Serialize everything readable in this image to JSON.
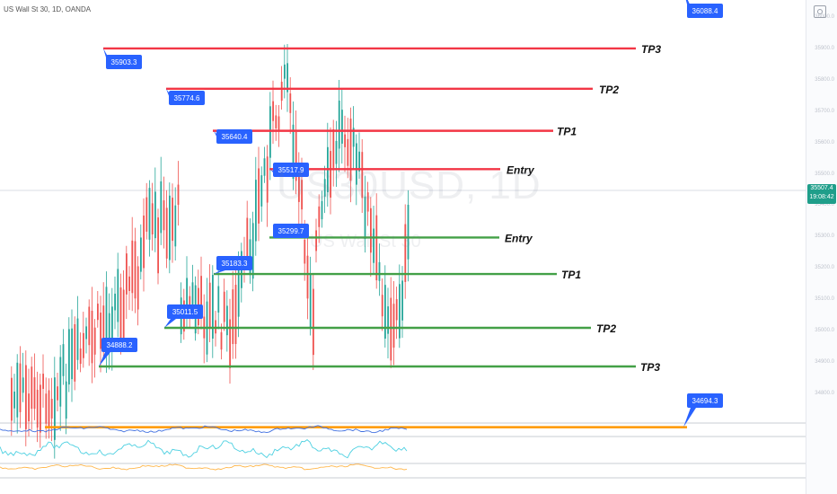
{
  "header": {
    "symbol_line": "US Wall St 30, 1D, OANDA"
  },
  "watermark": {
    "symbol": "US30USD, 1D",
    "name": "US Wall St 30"
  },
  "price_axis": {
    "current_price": "35507.4",
    "countdown": "19:08:42",
    "ticks": [
      "36100.0",
      "36000.0",
      "35900.0",
      "35800.0",
      "35700.0",
      "35600.0",
      "35500.0",
      "35400.0",
      "35300.0",
      "35200.0",
      "35100.0",
      "35000.0",
      "34900.0",
      "34800.0",
      "34700.0",
      "34600.0"
    ]
  },
  "colors": {
    "bull": "#26a69a",
    "bear": "#ef5350",
    "label_bg": "#2962ff",
    "range_line": "#ff9800",
    "short_line": "#f23645",
    "long_line": "#43a047",
    "osc1": "#3f6fe0",
    "osc2": "#4dd0e1",
    "osc3": "#ffb74d"
  },
  "levels": [
    {
      "id": "range-high",
      "price": "36088.4",
      "line": "range",
      "target": ""
    },
    {
      "id": "short-tp3",
      "price": "35903.3",
      "line": "short",
      "target": "TP3"
    },
    {
      "id": "short-tp2",
      "price": "35774.6",
      "line": "short",
      "target": "TP2"
    },
    {
      "id": "short-tp1",
      "price": "35640.4",
      "line": "short",
      "target": "TP1"
    },
    {
      "id": "short-entry",
      "price": "35517.9",
      "line": "short",
      "target": "Entry"
    },
    {
      "id": "long-entry",
      "price": "35299.7",
      "line": "long",
      "target": "Entry"
    },
    {
      "id": "long-tp1",
      "price": "35183.3",
      "line": "long",
      "target": "TP1"
    },
    {
      "id": "long-tp2",
      "price": "35011.5",
      "line": "long",
      "target": "TP2"
    },
    {
      "id": "long-tp3",
      "price": "34888.2",
      "line": "long",
      "target": "TP3"
    },
    {
      "id": "range-low",
      "price": "34694.3",
      "line": "range",
      "target": ""
    }
  ]
}
